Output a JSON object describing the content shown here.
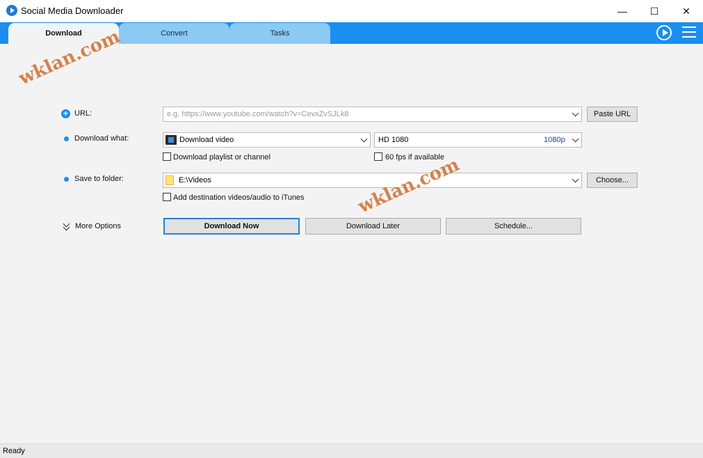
{
  "window": {
    "title": "Social Media Downloader",
    "controls": {
      "minimize": "—",
      "maximize": "☐",
      "close": "✕"
    }
  },
  "tabs": [
    {
      "label": "Download",
      "active": true
    },
    {
      "label": "Convert",
      "active": false
    },
    {
      "label": "Tasks",
      "active": false
    }
  ],
  "form": {
    "url_label": "URL:",
    "url_placeholder": "e.g. https://www.youtube.com/watch?v=CevxZvSJLk8",
    "paste_button": "Paste URL",
    "download_what_label": "Download what:",
    "download_type": "Download video",
    "quality": "HD 1080",
    "quality_tag": "1080p",
    "playlist_checkbox": "Download playlist or channel",
    "fps_checkbox": "60 fps if available",
    "save_label": "Save to folder:",
    "folder": "E:\\Videos",
    "choose_button": "Choose...",
    "itunes_checkbox": "Add destination videos/audio to iTunes",
    "more_options": "More Options",
    "download_now": "Download Now",
    "download_later": "Download Later",
    "schedule": "Schedule..."
  },
  "watermarks": [
    "wklan.com",
    "wklan.com"
  ],
  "status": {
    "text": "Ready"
  },
  "colors": {
    "accent": "#1a8ff0",
    "tab_inactive": "#8cc9f5",
    "background": "#f3f3f3"
  }
}
